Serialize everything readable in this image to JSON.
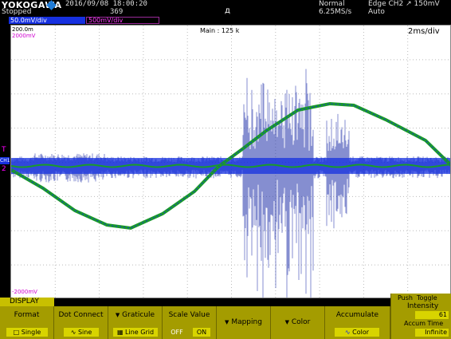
{
  "header": {
    "brand": "YOKOGAWA",
    "status": "Stopped",
    "datetime": "2016/09/08 18:00:20",
    "count": "369",
    "mode": "Normal",
    "sample_rate": "6.25MS/s",
    "trigger": "Edge CH2 ↗ 150mV",
    "trigger_mode": "Auto",
    "trig_pos_symbol": "д"
  },
  "channels": {
    "ch1_badge": "50.0mV/div",
    "ch2_badge": "500mV/div"
  },
  "screen": {
    "main_label": "Main : 125 k",
    "timebase": "2ms/div",
    "scale_top_ch1": "200.0m",
    "scale_top_ch2": "2000mV",
    "scale_bottom_ch2": "-2000mV",
    "trig_marker": "T",
    "ch1_marker": "CH1",
    "ch2_marker": "2"
  },
  "colors": {
    "screen_bg": "#ffffff",
    "ch1_trace": "#2233aa",
    "ch2_trace": "#1a9a2a",
    "menu_bg": "#a49c00",
    "menu_value_bg": "#d8d400"
  },
  "menu": {
    "tab": "DISPLAY",
    "buttons": [
      {
        "title": "Format",
        "value": "Single",
        "icon": "square-icon"
      },
      {
        "title": "Dot Connect",
        "value": "Sine",
        "icon": "sine-icon"
      },
      {
        "title": "Graticule",
        "value": "Line Grid",
        "icon": "grid-icon"
      },
      {
        "title": "Scale Value",
        "value_off": "OFF",
        "value_on": "ON"
      },
      {
        "title": "Mapping"
      },
      {
        "title": "Color"
      },
      {
        "title": "Accumulate",
        "value": "Color",
        "icon": "waveform-icon"
      }
    ]
  },
  "intensity": {
    "push_toggle": "Push",
    "toggle_label": "Toggle",
    "title": "Intensity",
    "value": "61",
    "accum_title": "Accum Time",
    "accum_value": "Infinite"
  }
}
